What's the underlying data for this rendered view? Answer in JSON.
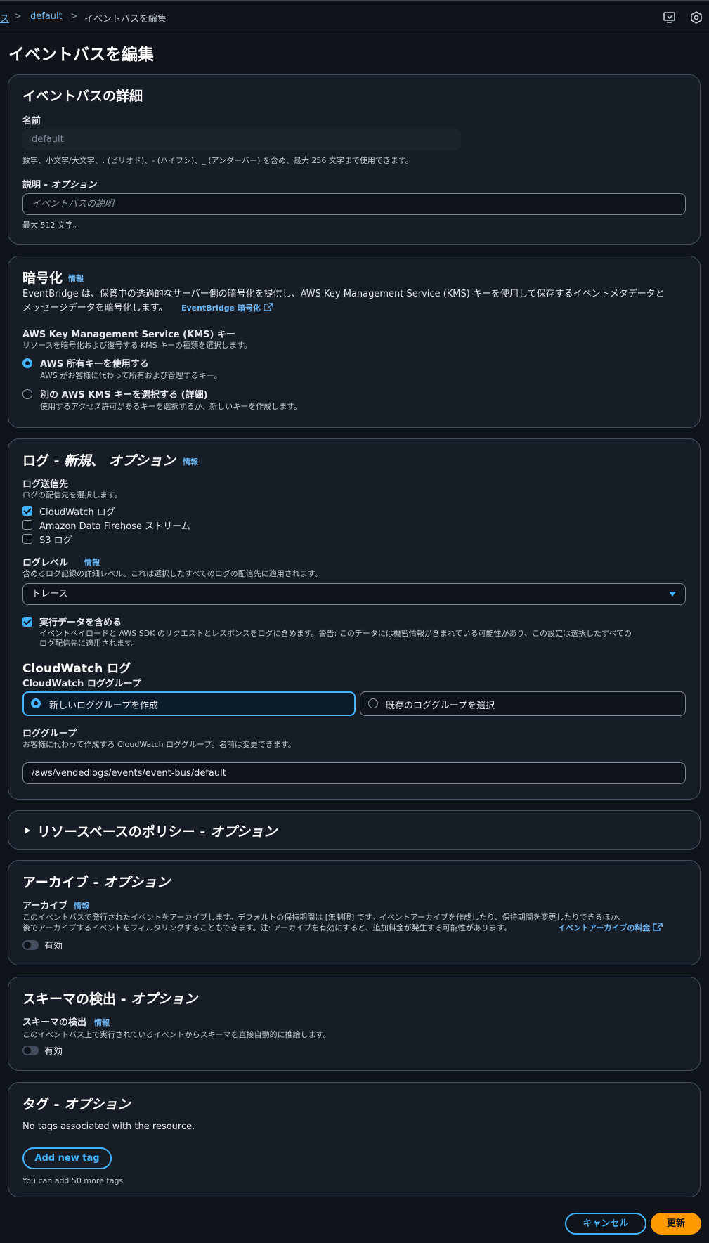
{
  "breadcrumb": {
    "prev_fragment": "ス",
    "sep": ">",
    "link": "default",
    "current": "イベントバスを編集"
  },
  "icons": {
    "top_left": "screen-capture-icon",
    "top_right": "settings-hex-icon"
  },
  "page_title": "イベントバスを編集",
  "details": {
    "title": "イベントバスの詳細",
    "name_label": "名前",
    "name_value": "default",
    "name_hint": "数字、小文字/大文字、. (ピリオド)、- (ハイフン)、_ (アンダーバー) を含め、最大 256 文字まで使用できます。",
    "desc_label": "説明 - ",
    "desc_label_option": "オプション",
    "desc_placeholder": "イベントバスの説明",
    "desc_hint": "最大 512 文字。"
  },
  "encryption": {
    "title": "暗号化",
    "info": "情報",
    "text_line1": "EventBridge は、保管中の透過的なサーバー側の暗号化を提供し、AWS Key Management Service (KMS) キーを使用して保存するイベントメタデータと",
    "text_line2": "メッセージデータを暗号化します。",
    "link": "EventBridge 暗号化",
    "kms_label": "AWS Key Management Service (KMS) キー",
    "kms_desc": "リソースを暗号化および復号する KMS キーの種類を選択します。",
    "option1_label": "AWS 所有キーを使用する",
    "option1_desc": "AWS がお客様に代わって所有および管理するキー。",
    "option2_label": "別の AWS KMS キーを選択する (詳細)",
    "option2_desc": "使用するアクセス許可があるキーを選択するか、新しいキーを作成します。"
  },
  "logs": {
    "title_prefix": "ログ - ",
    "title_italic": "新規、 オプション",
    "info": "情報",
    "dest_label": "ログ送信先",
    "dest_desc": "ログの配信先を選択します。",
    "dest_options": [
      "CloudWatch ログ",
      "Amazon Data Firehose ストリーム",
      "S3 ログ"
    ],
    "level_label": "ログレベル",
    "level_info": "情報",
    "level_desc": "含めるログ記録の詳細レベル。これは選択したすべてのログの配信先に適用されます。",
    "level_value": "トレース",
    "exec_label": "実行データを含める",
    "exec_desc_line1": "イベントペイロードと AWS SDK のリクエストとレスポンスをログに含めます。警告: このデータには機密情報が含まれている可能性があり、この設定は選択したすべての",
    "exec_desc_line2": "ログ配信先に適用されます。",
    "cw_title": "CloudWatch ログ",
    "cw_group_label": "CloudWatch ロググループ",
    "tile_new": "新しいロググループを作成",
    "tile_existing": "既存のロググループを選択",
    "group_label": "ロググループ",
    "group_desc": "お客様に代わって作成する CloudWatch ロググループ。名前は変更できます。",
    "group_value": "/aws/vendedlogs/events/event-bus/default"
  },
  "policy": {
    "title_prefix": "リソースベースのポリシー - ",
    "title_italic": "オプション"
  },
  "archive": {
    "title_prefix": "アーカイブ - ",
    "title_italic": "オプション",
    "label": "アーカイブ",
    "info": "情報",
    "desc_line1": "このイベントバスで発行されたイベントをアーカイブします。デフォルトの保持期間は [無制限] です。イベントアーカイブを作成したり、保持期間を変更したりできるほか、",
    "desc_line2": "後でアーカイブするイベントをフィルタリングすることもできます。注: アーカイブを有効にすると、追加料金が発生する可能性があります。",
    "link": "イベントアーカイブの料金",
    "toggle_label": "有効"
  },
  "schema": {
    "title_prefix": "スキーマの検出 - ",
    "title_italic": "オプション",
    "label": "スキーマの検出",
    "info": "情報",
    "desc": "このイベントバス上で実行されているイベントからスキーマを直接自動的に推論します。",
    "toggle_label": "有効"
  },
  "tags": {
    "title_prefix": "タグ - ",
    "title_italic": "オプション",
    "empty": "No tags associated with the resource.",
    "add_button": "Add new tag",
    "hint": "You can add 50 more tags"
  },
  "actions": {
    "cancel": "キャンセル",
    "update": "更新"
  },
  "colors": {
    "accent": "#42b4ff",
    "primary": "#ff9900",
    "background": "#0f141a",
    "panel": "#161d26"
  }
}
